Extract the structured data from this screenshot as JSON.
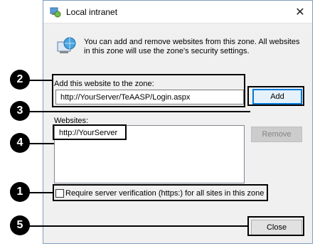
{
  "window": {
    "title": "Local intranet",
    "close_glyph": "✕"
  },
  "info": {
    "text": "You can add and remove websites from this zone. All websites in this zone will use the zone's security settings."
  },
  "add_section": {
    "label": "Add this website to the zone:",
    "value": "http://YourServer/TeAASP/Login.aspx",
    "add_button": "Add"
  },
  "websites": {
    "label": "Websites:",
    "items": [
      "http://YourServer"
    ],
    "remove_button": "Remove"
  },
  "verification": {
    "label": "Require server verification (https:) for all sites in this zone",
    "checked": false
  },
  "close_button": "Close",
  "callouts": [
    "1",
    "2",
    "3",
    "4",
    "5"
  ],
  "icons": [
    "zone-icon",
    "globe-computer-icon",
    "close-icon"
  ]
}
